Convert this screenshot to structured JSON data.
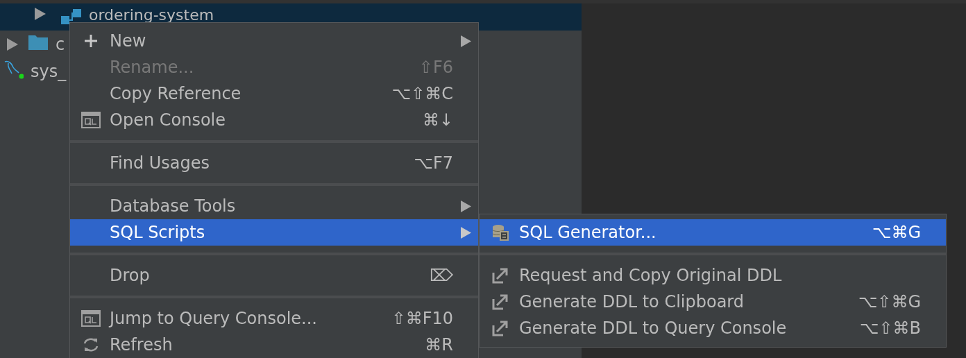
{
  "tree": {
    "items": [
      {
        "label": "ordering-system",
        "kind": "schema",
        "selected": true
      },
      {
        "label": "c",
        "kind": "folder",
        "selected": false
      },
      {
        "label": "sys_",
        "kind": "datasource",
        "selected": false
      }
    ]
  },
  "context_menu": {
    "items": [
      {
        "kind": "new",
        "label": "New",
        "submenu": true,
        "disabled": false,
        "selected": false
      },
      {
        "kind": "plain",
        "label": "Rename...",
        "shortcut": "⇧F6",
        "submenu": false,
        "disabled": true,
        "selected": false
      },
      {
        "kind": "plain",
        "label": "Copy Reference",
        "shortcut": "⌥⇧⌘C",
        "submenu": false,
        "disabled": false,
        "selected": false
      },
      {
        "kind": "console",
        "label": "Open Console",
        "shortcut": "⌘↓",
        "submenu": false,
        "disabled": false,
        "selected": false
      },
      {
        "kind": "separator"
      },
      {
        "kind": "plain",
        "label": "Find Usages",
        "shortcut": "⌥F7",
        "submenu": false,
        "disabled": false,
        "selected": false
      },
      {
        "kind": "separator"
      },
      {
        "kind": "plain",
        "label": "Database Tools",
        "submenu": true,
        "disabled": false,
        "selected": false
      },
      {
        "kind": "plain",
        "label": "SQL Scripts",
        "submenu": true,
        "disabled": false,
        "selected": true
      },
      {
        "kind": "separator"
      },
      {
        "kind": "plain",
        "label": "Drop",
        "shortcut": "⌦",
        "submenu": false,
        "disabled": false,
        "selected": false
      },
      {
        "kind": "separator"
      },
      {
        "kind": "console",
        "label": "Jump to Query Console...",
        "shortcut": "⇧⌘F10",
        "submenu": false,
        "disabled": false,
        "selected": false
      },
      {
        "kind": "refresh",
        "label": "Refresh",
        "shortcut": "⌘R",
        "submenu": false,
        "disabled": false,
        "selected": false
      }
    ]
  },
  "submenu": {
    "items": [
      {
        "kind": "generator",
        "label": "SQL Generator...",
        "shortcut": "⌥⌘G",
        "submenu": false,
        "disabled": false,
        "selected": true
      },
      {
        "kind": "separator"
      },
      {
        "kind": "export",
        "label": "Request and Copy Original DDL",
        "submenu": false,
        "disabled": false,
        "selected": false
      },
      {
        "kind": "export",
        "label": "Generate DDL to Clipboard",
        "shortcut": "⌥⇧⌘G",
        "submenu": false,
        "disabled": false,
        "selected": false
      },
      {
        "kind": "export",
        "label": "Generate DDL to Query Console",
        "shortcut": "⌥⇧⌘B",
        "submenu": false,
        "disabled": false,
        "selected": false
      }
    ]
  }
}
